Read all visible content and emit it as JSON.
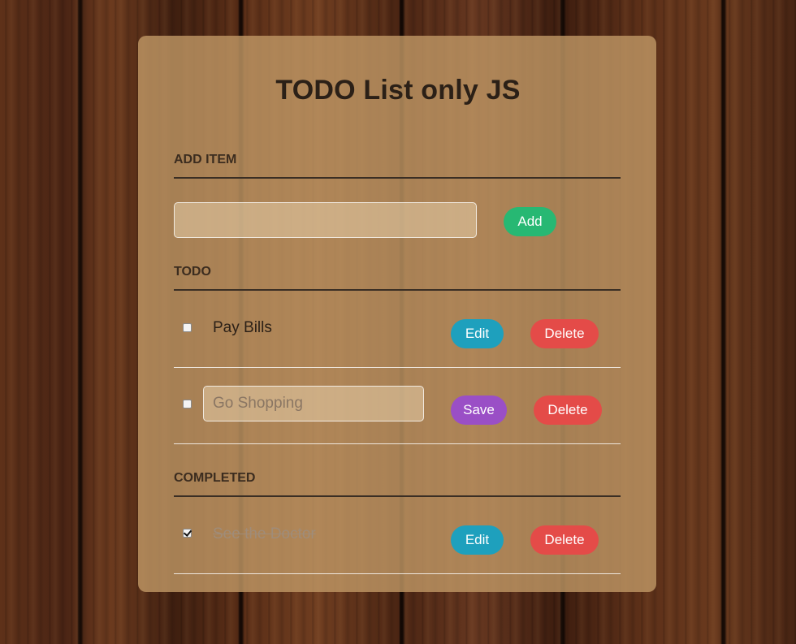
{
  "app": {
    "title": "TODO List only JS"
  },
  "add_section": {
    "heading": "ADD ITEM",
    "input_value": "",
    "add_label": "Add"
  },
  "todo_section": {
    "heading": "TODO",
    "items": [
      {
        "label": "Pay Bills",
        "checked": false,
        "editing": false,
        "edit_label": "Edit",
        "delete_label": "Delete"
      },
      {
        "label": "Go Shopping",
        "checked": false,
        "editing": true,
        "save_label": "Save",
        "delete_label": "Delete"
      }
    ]
  },
  "completed_section": {
    "heading": "COMPLETED",
    "items": [
      {
        "label": "See the Doctor",
        "checked": true,
        "edit_label": "Edit",
        "delete_label": "Delete"
      }
    ]
  },
  "colors": {
    "add_button": "#27b873",
    "edit_button": "#1ea0bd",
    "delete_button": "#e44b48",
    "save_button": "#9a4fc6",
    "card_background": "#be9664"
  }
}
